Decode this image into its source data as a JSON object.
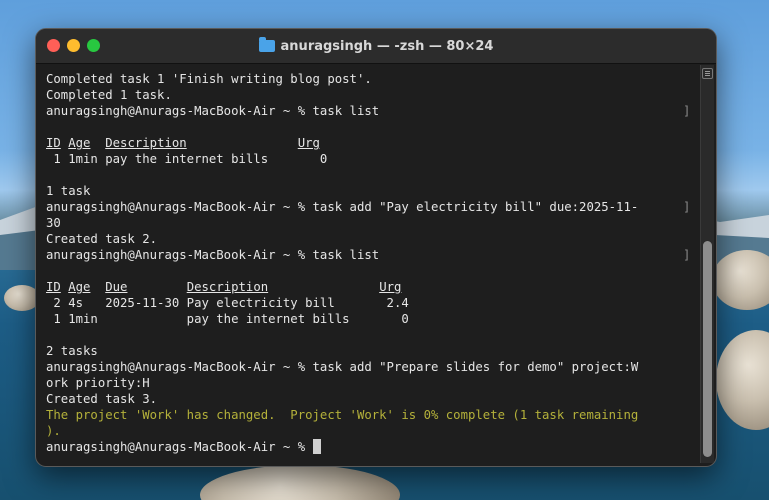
{
  "window": {
    "title": "anuragsingh — -zsh — 80×24",
    "folder_icon": "folder-icon"
  },
  "terminal": {
    "lines": [
      {
        "text": "Completed task 1 'Finish writing blog post'."
      },
      {
        "text": "Completed 1 task."
      },
      {
        "text": "anuragsingh@Anurags-MacBook-Air ~ % task list",
        "bracket": true
      },
      {
        "text": ""
      },
      {
        "text": "ID Age  Description               Urg "
      },
      {
        "text": " 1 1min pay the internet bills       0"
      },
      {
        "text": ""
      },
      {
        "text": "1 task"
      },
      {
        "text": "anuragsingh@Anurags-MacBook-Air ~ % task add \"Pay electricity bill\" due:2025-11-",
        "bracket": true
      },
      {
        "text": "30"
      },
      {
        "text": "Created task 2."
      },
      {
        "text": "anuragsingh@Anurags-MacBook-Air ~ % task list",
        "bracket": true
      },
      {
        "text": ""
      },
      {
        "text": "ID Age  Due        Description               Urg "
      },
      {
        "text": " 2 4s   2025-11-30 Pay electricity bill       2.4"
      },
      {
        "text": " 1 1min            pay the internet bills       0"
      },
      {
        "text": ""
      },
      {
        "text": "2 tasks"
      },
      {
        "text": "anuragsingh@Anurags-MacBook-Air ~ % task add \"Prepare slides for demo\" project:W"
      },
      {
        "text": "ork priority:H"
      },
      {
        "text": "Created task 3."
      },
      {
        "text": "The project 'Work' has changed.  Project 'Work' is 0% complete (1 task remaining",
        "color": "yellow"
      },
      {
        "text": ").",
        "color": "yellow"
      },
      {
        "text": "anuragsingh@Anurags-MacBook-Air ~ % ",
        "cursor": true
      }
    ]
  }
}
